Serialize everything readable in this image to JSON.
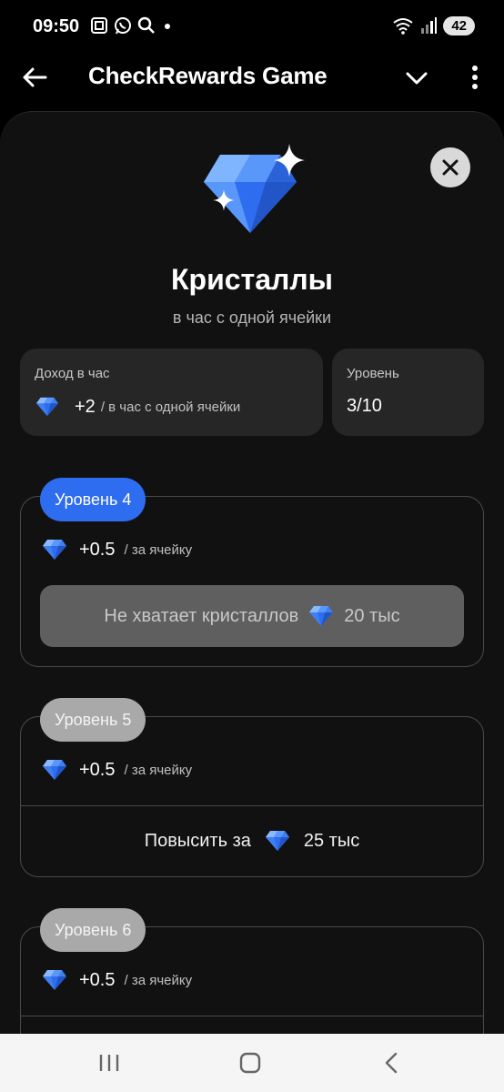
{
  "status_bar": {
    "time": "09:50",
    "battery": "42",
    "left_icons": [
      "screenshot-icon",
      "whatsapp-icon",
      "search-icon",
      "dot-icon"
    ],
    "right_icons": [
      "wifi-icon",
      "signal-icon",
      "battery-icon"
    ]
  },
  "app_bar": {
    "title": "CheckRewards Game",
    "icons": [
      "back-arrow-icon",
      "chevron-down-icon",
      "more-vert-icon"
    ]
  },
  "sheet": {
    "title": "Кристаллы",
    "subtitle": "в час с одной ячейки",
    "income_card": {
      "label": "Доход в час",
      "value": "+2",
      "unit": "/ в час с одной ячейки"
    },
    "level_card": {
      "label": "Уровень",
      "value": "3/10"
    },
    "levels": [
      {
        "name": "Уровень 4",
        "reward": "+0.5",
        "unit": "/ за ячейку",
        "button_text": "Не хватает кристаллов",
        "price": "20 тыс",
        "state": "active"
      },
      {
        "name": "Уровень 5",
        "reward": "+0.5",
        "unit": "/ за ячейку",
        "button_text": "Повысить за",
        "price": "25 тыс",
        "state": "locked"
      },
      {
        "name": "Уровень 6",
        "reward": "+0.5",
        "unit": "/ за ячейку",
        "state": "locked"
      }
    ]
  },
  "colors": {
    "accent": "#2f6df0",
    "sheet_bg": "#111111",
    "card_bg": "#262626",
    "gem_light": "#6fa8ff",
    "gem_dark": "#2a62d8"
  },
  "nav_bar": {
    "icons": [
      "recents-icon",
      "home-icon",
      "back-icon"
    ]
  }
}
